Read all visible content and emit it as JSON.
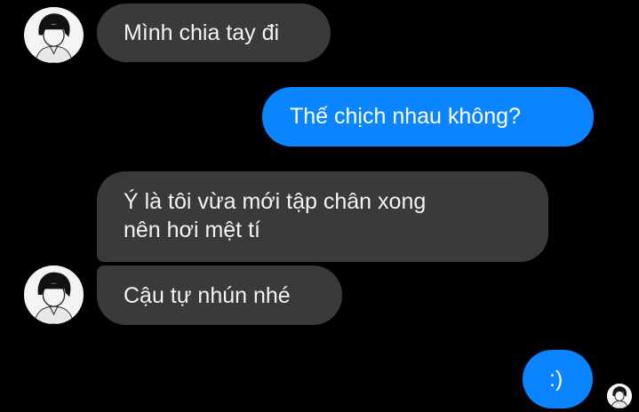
{
  "conversation": {
    "messages": [
      {
        "sender": "them",
        "lines": [
          "Mình chia tay đi"
        ]
      },
      {
        "sender": "me",
        "lines": [
          "Thế chịch nhau không?"
        ]
      },
      {
        "sender": "them",
        "lines": [
          "Ý là tôi vừa mới tập chân xong",
          "nên hơi mệt tí"
        ]
      },
      {
        "sender": "them",
        "lines": [
          "Cậu tự nhún nhé"
        ]
      },
      {
        "sender": "me",
        "lines": [
          ":)"
        ]
      }
    ]
  },
  "icons": {
    "contact_avatar": "person-avatar-icon",
    "seen_indicator": "seen-avatar-icon"
  },
  "colors": {
    "background": "#000000",
    "incoming_bubble": "#3a3a3c",
    "outgoing_bubble": "#0a84ff",
    "text": "#ffffff"
  }
}
